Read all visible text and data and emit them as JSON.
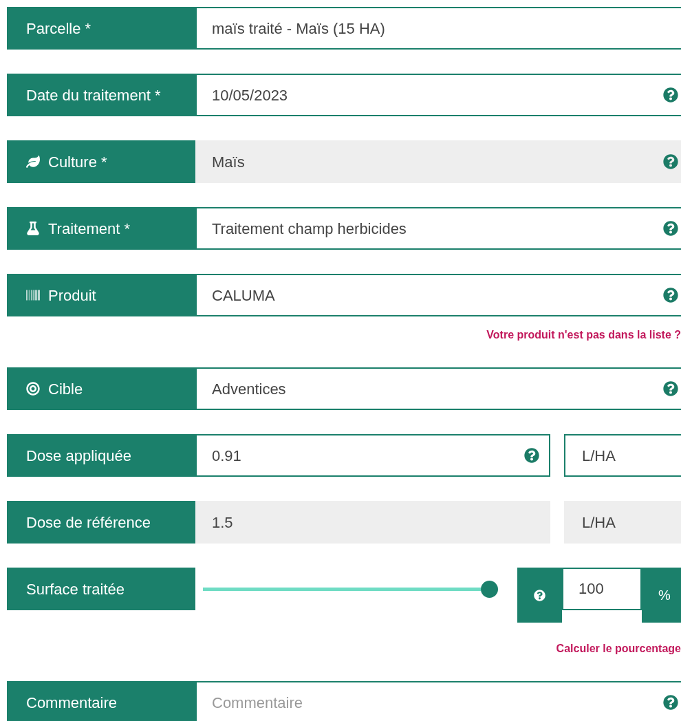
{
  "rows": [
    {
      "kind": "input",
      "label": "Parcelle *",
      "value": "maïs traité - Maïs (15 HA)",
      "help": false
    },
    {
      "kind": "input",
      "label": "Date du traitement *",
      "value": "10/05/2023",
      "help": true
    },
    {
      "kind": "readonly",
      "label": "Culture *",
      "value": "Maïs",
      "help": true
    },
    {
      "kind": "input",
      "label": "Traitement *",
      "value": "Traitement champ herbicides",
      "help": true
    },
    {
      "kind": "input",
      "label": "Produit",
      "value": "CALUMA",
      "help": true,
      "link": "Votre produit n'est pas dans la liste ?"
    },
    {
      "kind": "input",
      "label": "Cible",
      "value": "Adventices",
      "help": true
    },
    {
      "kind": "split",
      "label": "Dose appliquée",
      "value": "0.91",
      "unit": "L/HA",
      "help": true,
      "disabled": false
    },
    {
      "kind": "split",
      "label": "Dose de référence",
      "value": "1.5",
      "unit": "L/HA",
      "help": false,
      "disabled": true
    },
    {
      "kind": "slider",
      "label": "Surface traitée",
      "level": 1,
      "value": "100",
      "unit": "%",
      "help": true,
      "link": "Calculer le pourcentage"
    },
    {
      "kind": "input",
      "label": "Commentaire",
      "placeholder": "Commentaire",
      "help": true
    }
  ]
}
